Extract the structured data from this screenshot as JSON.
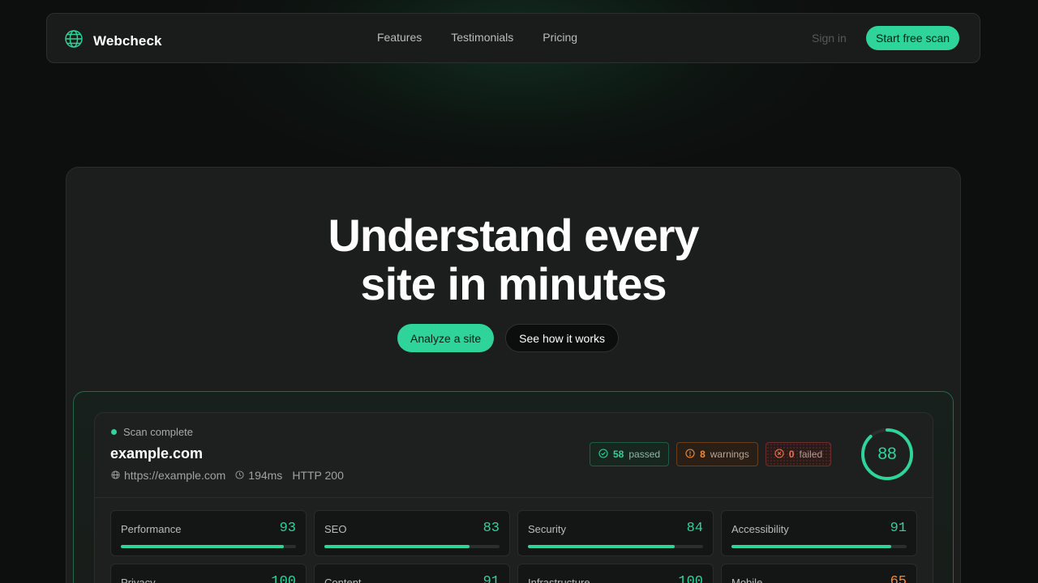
{
  "colors": {
    "accent": "#2fd49a",
    "warning": "#f08a3a",
    "danger": "#f0704f"
  },
  "nav": {
    "brand": "Webcheck",
    "logo_icon": "globe-icon",
    "links": [
      "Features",
      "Testimonials",
      "Pricing"
    ],
    "sign_in": "Sign in",
    "cta": "Start free scan"
  },
  "hero": {
    "title_line1": "Understand every",
    "title_line2": "site in minutes",
    "primary_cta": "Analyze a site",
    "secondary_cta": "See how it works"
  },
  "report": {
    "status": "Scan complete",
    "domain": "example.com",
    "url": "https://example.com",
    "response_time": "194ms",
    "http_status": "HTTP 200",
    "badges": {
      "passed": {
        "count": "58",
        "label": "passed"
      },
      "warnings": {
        "count": "8",
        "label": "warnings"
      },
      "failed": {
        "count": "0",
        "label": "failed"
      }
    },
    "overall_score": 88,
    "categories": [
      {
        "label": "Performance",
        "score": 93
      },
      {
        "label": "SEO",
        "score": 83
      },
      {
        "label": "Security",
        "score": 84
      },
      {
        "label": "Accessibility",
        "score": 91
      },
      {
        "label": "Privacy",
        "score": 100
      },
      {
        "label": "Content",
        "score": 91
      },
      {
        "label": "Infrastructure",
        "score": 100
      },
      {
        "label": "Mobile",
        "score": 65
      }
    ]
  }
}
